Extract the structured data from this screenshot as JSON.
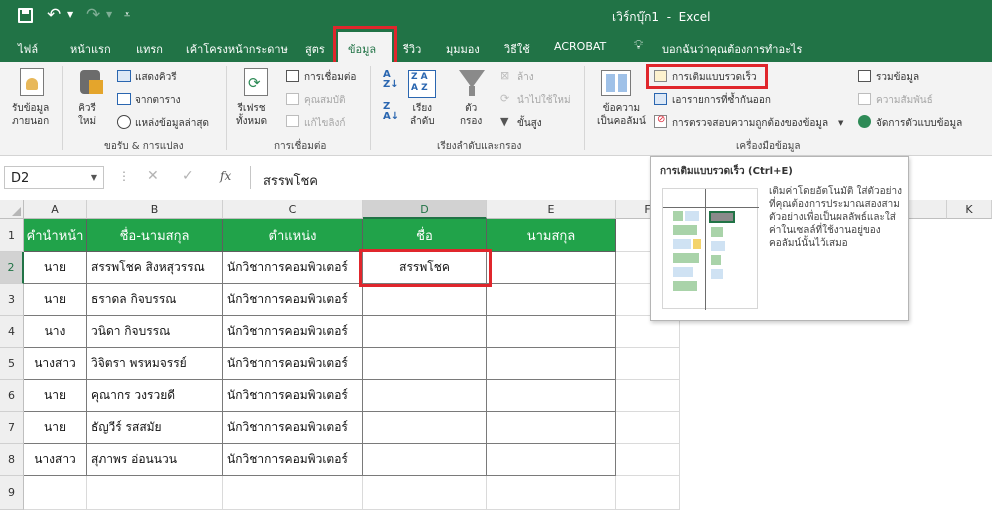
{
  "titlebar": {
    "title": "เวิร์กบุ๊ก1  -  Excel"
  },
  "tabs": [
    "ไฟล์",
    "หน้าแรก",
    "แทรก",
    "เค้าโครงหน้ากระดาษ",
    "สูตร",
    "ข้อมูล",
    "รีวิว",
    "มุมมอง",
    "วิธีใช้",
    "ACROBAT"
  ],
  "tell_me": "บอกฉันว่าคุณต้องการทำอะไร",
  "ribbon": {
    "get_data": [
      "รับข้อมูล",
      "ภายนอก"
    ],
    "new_query": [
      "คิวรี",
      "ใหม่"
    ],
    "show_queries": "แสดงคิวรี",
    "from_table": "จากตาราง",
    "recent_sources": "แหล่งข้อมูลล่าสุด",
    "get_transform_label": "ขอรับ & การแปลง",
    "refresh_all": [
      "รีเฟรช",
      "ทั้งหมด"
    ],
    "connections": "การเชื่อมต่อ",
    "properties": "คุณสมบัติ",
    "edit_links": "แก้ไขลิงก์",
    "connections_label": "การเชื่อมต่อ",
    "sort": [
      "เรียง",
      "ลำดับ"
    ],
    "filter": [
      "ตัว",
      "กรอง"
    ],
    "clear": "ล้าง",
    "reapply": "นำไปใช้ใหม่",
    "advanced": "ขั้นสูง",
    "sort_filter_label": "เรียงลำดับและกรอง",
    "text_to_columns": [
      "ข้อความ",
      "เป็นคอลัมน์"
    ],
    "flash_fill": "การเติมแบบรวดเร็ว",
    "remove_duplicates": "เอารายการที่ซ้ำกันออก",
    "data_validation": "การตรวจสอบความถูกต้องของข้อมูล",
    "consolidate": "รวมข้อมูล",
    "relationships": "ความสัมพันธ์",
    "manage_data_model": "จัดการตัวแบบข้อมูล",
    "data_tools_label": "เครื่องมือข้อมูล"
  },
  "formula_bar": {
    "name_box": "D2",
    "fx": "fx",
    "content": "สรรพโชค"
  },
  "columns": [
    "A",
    "B",
    "C",
    "D",
    "E",
    "F",
    "K"
  ],
  "rows": [
    "1",
    "2",
    "3",
    "4",
    "5",
    "6",
    "7",
    "8",
    "9"
  ],
  "table": {
    "headers": [
      "คำนำหน้า",
      "ชื่อ-นามสกุล",
      "ตำแหน่ง",
      "ชื่อ",
      "นามสกุล"
    ],
    "rows": [
      [
        "นาย",
        "สรรพโชค สิงหสุวรรณ",
        "นักวิชาการคอมพิวเตอร์",
        "สรรพโชค",
        ""
      ],
      [
        "นาย",
        "ธราดล กิจบรรณ",
        "นักวิชาการคอมพิวเตอร์",
        "",
        ""
      ],
      [
        "นาง",
        "วนิดา กิจบรรณ",
        "นักวิชาการคอมพิวเตอร์",
        "",
        ""
      ],
      [
        "นางสาว",
        "วิจิตรา พรหมจรรย์",
        "นักวิชาการคอมพิวเตอร์",
        "",
        ""
      ],
      [
        "นาย",
        "คุณากร วงรวยดี",
        "นักวิชาการคอมพิวเตอร์",
        "",
        ""
      ],
      [
        "นาย",
        "ธัญวีร์ รสสมัย",
        "นักวิชาการคอมพิวเตอร์",
        "",
        ""
      ],
      [
        "นางสาว",
        "สุภาพร อ่อนนวน",
        "นักวิชาการคอมพิวเตอร์",
        "",
        ""
      ]
    ]
  },
  "tooltip": {
    "title": "การเติมแบบรวดเร็ว (Ctrl+E)",
    "body": "เติมค่าโดยอัตโนมัติ ใส่ตัวอย่างที่คุณต้องการประมาณสองสามตัวอย่างเพื่อเป็นผลลัพธ์และใส่ค่าในเซลล์ที่ใช้งานอยู่ของคอลัมน์นั้นไว้เสมอ"
  },
  "colors": {
    "excel_green": "#217346",
    "header_fill": "#21a34a",
    "highlight": "#e0262c"
  }
}
